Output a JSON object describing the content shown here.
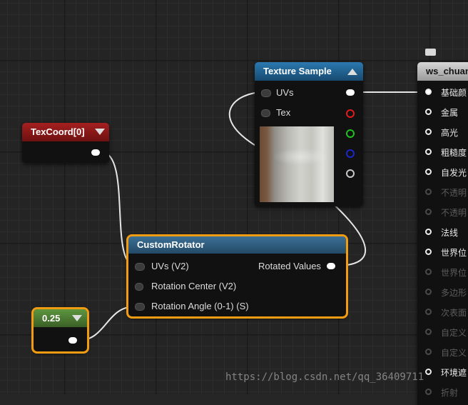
{
  "nodes": {
    "texcoord": {
      "title": "TexCoord[0]",
      "header_color": "#8a1616"
    },
    "texture_sample": {
      "title": "Texture Sample",
      "header_color": "#1d5e8a",
      "inputs": [
        "UVs",
        "Tex"
      ],
      "output_pin_colors": [
        "#ffffff",
        "#e01d1d",
        "#1ec11e",
        "#1c27c9",
        "#c8c8c8"
      ]
    },
    "custom_rotator": {
      "title": "CustomRotator",
      "header_color": "#2f5a7a",
      "inputs": [
        "UVs (V2)",
        "Rotation Center (V2)",
        "Rotation Angle (0-1) (S)"
      ],
      "output": "Rotated Values"
    },
    "constant": {
      "value": "0.25",
      "header_color": "#4b7a30"
    },
    "result": {
      "title": "ws_chuan",
      "pins": [
        {
          "label": "基础颜",
          "enabled": true,
          "connected": true
        },
        {
          "label": "金属",
          "enabled": true
        },
        {
          "label": "高光",
          "enabled": true
        },
        {
          "label": "粗糙度",
          "enabled": true
        },
        {
          "label": "自发光",
          "enabled": true
        },
        {
          "label": "不透明",
          "enabled": false
        },
        {
          "label": "不透明",
          "enabled": false
        },
        {
          "label": "法线",
          "enabled": true
        },
        {
          "label": "世界位",
          "enabled": true
        },
        {
          "label": "世界位",
          "enabled": false
        },
        {
          "label": "多边形",
          "enabled": false
        },
        {
          "label": "次表面",
          "enabled": false
        },
        {
          "label": "自定义",
          "enabled": false
        },
        {
          "label": "自定义",
          "enabled": false
        },
        {
          "label": "环境遮",
          "enabled": true
        },
        {
          "label": "折射",
          "enabled": false
        }
      ]
    }
  },
  "watermark": "https://blog.csdn.net/qq_36409711",
  "accent_selection": "#f29c12"
}
